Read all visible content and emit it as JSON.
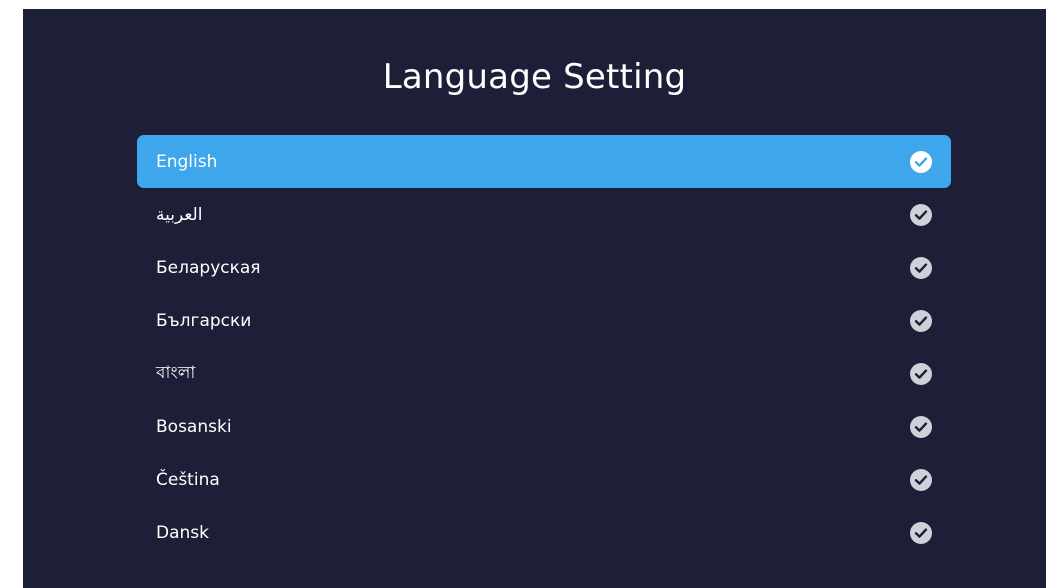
{
  "screen": {
    "title": "Language Setting"
  },
  "languages": {
    "selected_index": 0,
    "items": [
      {
        "label": "English",
        "selected": true
      },
      {
        "label": "العربية",
        "selected": false
      },
      {
        "label": "Беларуская",
        "selected": false
      },
      {
        "label": "Български",
        "selected": false
      },
      {
        "label": "বাংলা",
        "selected": false
      },
      {
        "label": "Bosanski",
        "selected": false
      },
      {
        "label": "Čeština",
        "selected": false
      },
      {
        "label": "Dansk",
        "selected": false
      }
    ]
  },
  "colors": {
    "background": "#1d1f38",
    "highlight": "#3ea6ea",
    "text": "#ffffff",
    "check_icon": "#cfd0d8"
  },
  "icons": {
    "item_indicator": "check-circle-icon"
  }
}
